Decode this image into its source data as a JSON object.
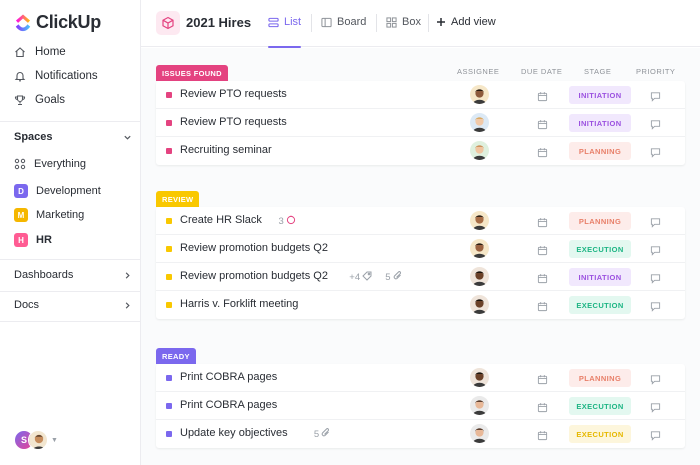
{
  "app": {
    "name": "ClickUp"
  },
  "sidebar": {
    "nav": [
      {
        "label": "Home",
        "icon": "home-icon"
      },
      {
        "label": "Notifications",
        "icon": "bell-icon"
      },
      {
        "label": "Goals",
        "icon": "trophy-icon"
      }
    ],
    "spaces_heading": "Spaces",
    "everything_label": "Everything",
    "spaces": [
      {
        "letter": "D",
        "label": "Development",
        "color": "#7b68ee"
      },
      {
        "letter": "M",
        "label": "Marketing",
        "color": "#f5b700"
      },
      {
        "letter": "H",
        "label": "HR",
        "color": "#ff5c93"
      }
    ],
    "dashboards_label": "Dashboards",
    "docs_label": "Docs",
    "user_initial": "S"
  },
  "header": {
    "title": "2021 Hires",
    "views": [
      {
        "label": "List",
        "icon": "list-view-icon",
        "active": true
      },
      {
        "label": "Board",
        "icon": "board-view-icon",
        "active": false
      },
      {
        "label": "Box",
        "icon": "box-view-icon",
        "active": false
      }
    ],
    "add_view_label": "Add view"
  },
  "columns": {
    "assignee": "ASSIGNEE",
    "due_date": "DUE DATE",
    "stage": "STAGE",
    "priority": "PRIORITY"
  },
  "stages": {
    "INITIATION": {
      "bg": "#f1e8fd",
      "fg": "#9b51e0"
    },
    "PLANNING": {
      "bg": "#fdecea",
      "fg": "#e8806a"
    },
    "EXECUTION": {
      "bg": "#e3f8f0",
      "fg": "#1db584"
    },
    "EXECUTION_Y": {
      "bg": "#fdf6dc",
      "fg": "#e6b800"
    }
  },
  "groups": [
    {
      "label": "ISSUES FOUND",
      "color": "#e44380",
      "tasks": [
        {
          "name": "Review PTO requests",
          "assignee": "person-1",
          "stage": "INITIATION",
          "stage_key": "INITIATION"
        },
        {
          "name": "Review PTO requests",
          "assignee": "person-2",
          "stage": "INITIATION",
          "stage_key": "INITIATION"
        },
        {
          "name": "Recruiting seminar",
          "assignee": "person-3",
          "stage": "PLANNING",
          "stage_key": "PLANNING"
        }
      ]
    },
    {
      "label": "REVIEW",
      "color": "#f9c800",
      "tasks": [
        {
          "name": "Create HR Slack",
          "assignee": "person-4",
          "stage": "PLANNING",
          "stage_key": "PLANNING",
          "extras": [
            {
              "text": "3",
              "icon": "subtask-icon"
            }
          ]
        },
        {
          "name": "Review promotion budgets Q2",
          "assignee": "person-5",
          "stage": "EXECUTION",
          "stage_key": "EXECUTION"
        },
        {
          "name": "Review promotion budgets Q2",
          "assignee": "person-6",
          "stage": "INITIATION",
          "stage_key": "INITIATION",
          "extras": [
            {
              "text": "+4",
              "icon": "tag-icon"
            },
            {
              "text": "5",
              "icon": "paperclip-icon"
            }
          ]
        },
        {
          "name": "Harris v. Forklift meeting",
          "assignee": "person-6",
          "stage": "EXECUTION",
          "stage_key": "EXECUTION"
        }
      ]
    },
    {
      "label": "READY",
      "color": "#7b68ee",
      "tasks": [
        {
          "name": "Print COBRA pages",
          "assignee": "person-6",
          "stage": "PLANNING",
          "stage_key": "PLANNING"
        },
        {
          "name": "Print COBRA pages",
          "assignee": "person-7",
          "stage": "EXECUTION",
          "stage_key": "EXECUTION"
        },
        {
          "name": "Update key objectives",
          "assignee": "person-7",
          "stage": "EXECUTION",
          "stage_key": "EXECUTION_Y",
          "extras": [
            {
              "text": "5",
              "icon": "paperclip-icon"
            }
          ]
        }
      ]
    }
  ]
}
